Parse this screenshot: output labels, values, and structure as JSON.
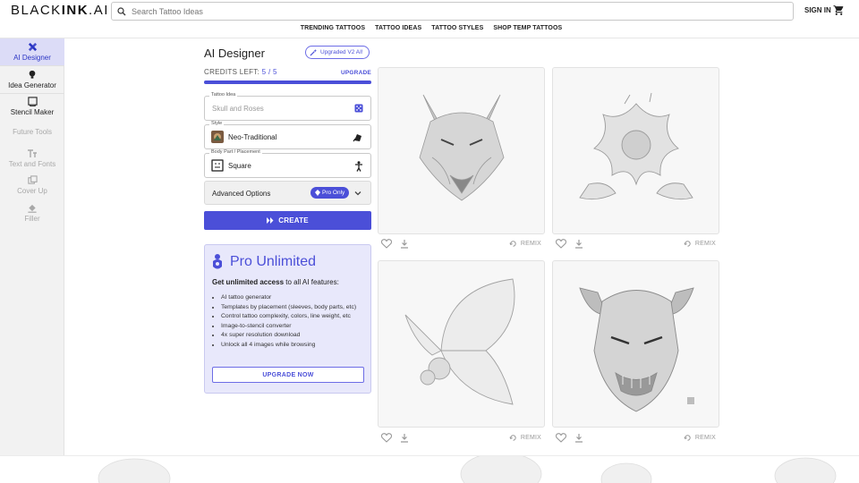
{
  "header": {
    "logo_light": "BLACK",
    "logo_bold": "INK",
    "logo_suffix": ".AI",
    "search_placeholder": "Search Tattoo Ideas",
    "signin": "SIGN IN",
    "cart_icon": "cart-icon"
  },
  "nav": [
    "TRENDING TATTOOS",
    "TATTOO IDEAS",
    "TATTOO STYLES",
    "SHOP TEMP TATTOOS"
  ],
  "sidebar": {
    "items": [
      {
        "label": "AI Designer",
        "icon": "tools-icon",
        "active": true
      },
      {
        "label": "Idea Generator",
        "icon": "lightbulb-icon"
      },
      {
        "label": "Stencil Maker",
        "icon": "stencil-icon"
      }
    ],
    "future_label": "Future Tools",
    "future_items": [
      {
        "label": "Text and Fonts",
        "icon": "text-icon"
      },
      {
        "label": "Cover Up",
        "icon": "layers-icon"
      },
      {
        "label": "Filler",
        "icon": "paint-bucket-icon"
      }
    ]
  },
  "designer": {
    "title": "AI Designer",
    "v2_badge": "Upgraded V2 AI!",
    "credits_label": "CREDITS LEFT:",
    "credits_used": "5",
    "credits_sep": "/",
    "credits_total": "5",
    "credits_fraction": 1.0,
    "upgrade_link": "UPGRADE",
    "tattoo_idea_label": "Tattoo Idea",
    "tattoo_idea_placeholder": "Skull and Roses",
    "style_label": "Style",
    "style_value": "Neo-Traditional",
    "placement_label": "Body Part / Placement",
    "placement_value": "Square",
    "advanced_label": "Advanced Options",
    "pro_only": "Pro Only",
    "create_label": "CREATE"
  },
  "pro": {
    "title": "Pro Unlimited",
    "sub_bold": "Get unlimited access",
    "sub_rest": " to all AI features:",
    "features": [
      "AI tattoo generator",
      "Templates by placement (sleeves, body parts, etc)",
      "Control tattoo complexity, colors, line weight, etc",
      "Image-to-stencil converter",
      "4x super resolution download",
      "Unlock all 4 images while browsing"
    ],
    "button": "UPGRADE NOW"
  },
  "gallery": {
    "remix_label": "REMIX",
    "images": [
      "wolf-image",
      "flower-image",
      "butterfly-image",
      "oni-mask-image"
    ]
  },
  "colors": {
    "accent": "#4b4fd8",
    "accent_light": "#e8e8fb",
    "sidebar_bg": "#f2f2f2"
  }
}
